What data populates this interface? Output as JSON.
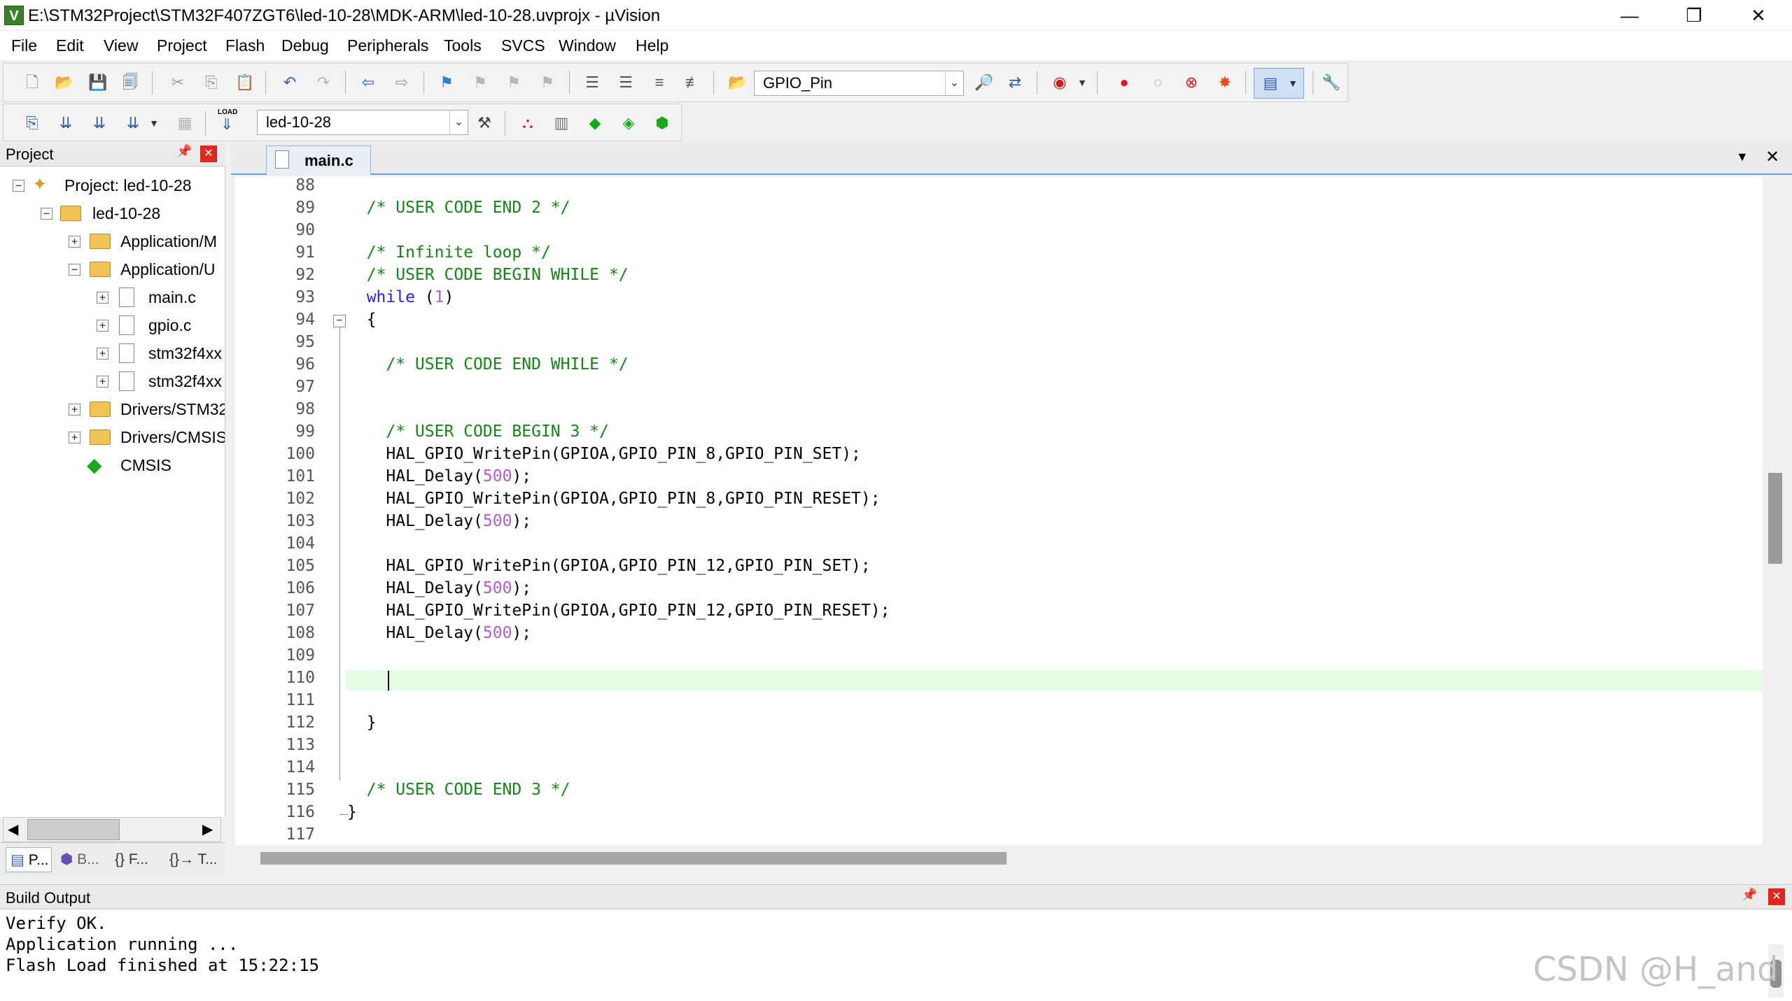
{
  "window": {
    "icon_letter": "V",
    "title": "E:\\STM32Project\\STM32F407ZGT6\\led-10-28\\MDK-ARM\\led-10-28.uvprojx - µVision",
    "controls": [
      "—",
      "❐",
      "✕"
    ]
  },
  "menu": [
    "File",
    "Edit",
    "View",
    "Project",
    "Flash",
    "Debug",
    "Peripherals",
    "Tools",
    "SVCS",
    "Window",
    "Help"
  ],
  "toolbar1": {
    "find_combo": "GPIO_Pin"
  },
  "toolbar2": {
    "load_label": "LOAD",
    "target_combo": "led-10-28"
  },
  "project_panel": {
    "title": "Project",
    "pin_icon": "📌",
    "close_icon": "✕",
    "tree": [
      {
        "label": "Project: led-10-28",
        "expander": "−"
      },
      {
        "label": "led-10-28",
        "expander": "−"
      },
      {
        "label": "Application/M",
        "expander": "+"
      },
      {
        "label": "Application/U",
        "expander": "−"
      },
      {
        "label": "main.c",
        "expander": "+"
      },
      {
        "label": "gpio.c",
        "expander": "+"
      },
      {
        "label": "stm32f4xx",
        "expander": "+"
      },
      {
        "label": "stm32f4xx",
        "expander": "+"
      },
      {
        "label": "Drivers/STM32",
        "expander": "+"
      },
      {
        "label": "Drivers/CMSIS",
        "expander": "+"
      },
      {
        "label": "CMSIS",
        "expander": ""
      }
    ],
    "tabs": [
      "P...",
      "B...",
      "{} F...",
      "{}→ T..."
    ]
  },
  "editor": {
    "tab": "main.c",
    "line_numbers": [
      "88",
      "89",
      "90",
      "91",
      "92",
      "93",
      "94",
      "95",
      "96",
      "97",
      "98",
      "99",
      "100",
      "101",
      "102",
      "103",
      "104",
      "105",
      "106",
      "107",
      "108",
      "109",
      "110",
      "111",
      "112",
      "113",
      "114",
      "115",
      "116",
      "117"
    ],
    "lines": [
      "",
      "  /* USER CODE END 2 */",
      "",
      "  /* Infinite loop */",
      "  /* USER CODE BEGIN WHILE */",
      "  while (1)",
      "  {",
      "",
      "    /* USER CODE END WHILE */",
      "",
      "",
      "    /* USER CODE BEGIN 3 */",
      "    HAL_GPIO_WritePin(GPIOA,GPIO_PIN_8,GPIO_PIN_SET);",
      "    HAL_Delay(500);",
      "    HAL_GPIO_WritePin(GPIOA,GPIO_PIN_8,GPIO_PIN_RESET);",
      "    HAL_Delay(500);",
      "",
      "    HAL_GPIO_WritePin(GPIOA,GPIO_PIN_12,GPIO_PIN_SET);",
      "    HAL_Delay(500);",
      "    HAL_GPIO_WritePin(GPIOA,GPIO_PIN_12,GPIO_PIN_RESET);",
      "    HAL_Delay(500);",
      "",
      "",
      "",
      "  }",
      "",
      "",
      "  /* USER CODE END 3 */",
      "}",
      ""
    ]
  },
  "build_output": {
    "title": "Build Output",
    "lines": [
      "Verify OK.",
      "Application running ...",
      "Flash Load finished at 15:22:15"
    ]
  },
  "watermark": "CSDN @H_and",
  "colors": {
    "comment": "#118811",
    "keyword": "#1e1eff",
    "number": "#b45ad6",
    "current_line": "#e4fbe6"
  }
}
